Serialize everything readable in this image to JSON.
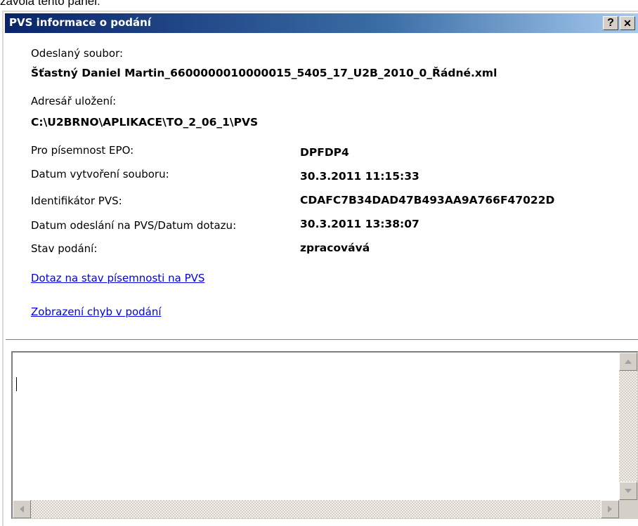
{
  "above_text": "zavola tento panel:",
  "dialog": {
    "title": "PVS informace o podání",
    "help_label": "?",
    "close_label": "✕"
  },
  "fields": {
    "odeslany_label": "Odeslaný soubor:",
    "odeslany_value": "Šťastný Daniel Martin_6600000010000015_5405_17_U2B_2010_0_Řádné.xml",
    "adresar_label": "Adresář uložení:",
    "adresar_value": "C:\\U2BRNO\\APLIKACE\\TO_2_06_1\\PVS",
    "epo_label": "Pro písemnost EPO:",
    "epo_value": "DPFDP4",
    "datum_vytvoreni_label": "Datum vytvoření souboru:",
    "datum_vytvoreni_value": "30.3.2011 11:15:33",
    "identifikator_label": "Identifikátor PVS:",
    "identifikator_value": "CDAFC7B34DAD47B493AA9A766F47022D",
    "datum_odeslani_label": "Datum odeslání na PVS/Datum dotazu:",
    "datum_odeslani_value": "30.3.2011 13:38:07",
    "stav_label": "Stav podání:",
    "stav_value": "zpracovává"
  },
  "links": {
    "dotaz": "Dotaz na stav písemnosti na PVS",
    "chyby": "Zobrazení chyb v podání"
  },
  "memo": {
    "value": ""
  },
  "icons": {
    "help": "question-icon",
    "close": "close-icon",
    "scroll_up": "arrow-up-icon",
    "scroll_down": "arrow-down-icon",
    "scroll_left": "arrow-left-icon",
    "scroll_right": "arrow-right-icon"
  }
}
